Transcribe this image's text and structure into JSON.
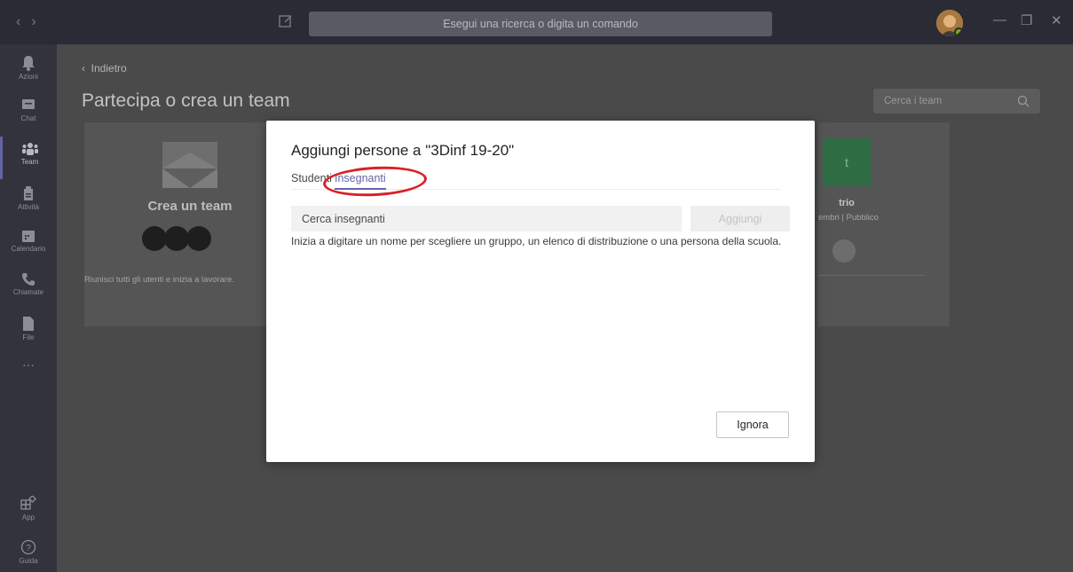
{
  "topbar": {
    "search_placeholder": "Esegui una ricerca o digita un comando",
    "icons": [
      "back-arrow-icon",
      "forward-arrow-icon",
      "compose-icon",
      "minimize-icon",
      "maximize-icon",
      "close-icon"
    ]
  },
  "rail": {
    "items": [
      {
        "label": "Azioni",
        "icon": "bell-icon"
      },
      {
        "label": "Chat",
        "icon": "chat-icon"
      },
      {
        "label": "Team",
        "icon": "team-icon",
        "active": true
      },
      {
        "label": "Attività",
        "icon": "assignments-icon"
      },
      {
        "label": "Calendario",
        "icon": "calendar-icon"
      },
      {
        "label": "Chiamate",
        "icon": "phone-icon"
      },
      {
        "label": "File",
        "icon": "file-icon"
      },
      {
        "label": "App",
        "icon": "apps-icon"
      },
      {
        "label": "Guida",
        "icon": "help-icon"
      }
    ],
    "more_label": "···"
  },
  "main": {
    "back_label": "Indietro",
    "title": "Partecipa o crea un team",
    "team_search_placeholder": "Cerca i team",
    "create_card": {
      "title": "Crea un team",
      "description": "Riunisci tutti gli utenti e inizia a lavorare."
    },
    "trio_card": {
      "tile_letter": "t",
      "name": "trio",
      "meta": "embri | Pubblico"
    }
  },
  "dialog": {
    "title": "Aggiungi persone a \"3Dinf 19-20\"",
    "tabs": [
      {
        "label": "Studenti",
        "active": false
      },
      {
        "label": "Insegnanti",
        "active": true
      }
    ],
    "search_placeholder": "Cerca insegnanti",
    "add_label": "Aggiungi",
    "hint": "Inizia a digitare un nome per scegliere un gruppo, un elenco di distribuzione o una persona della scuola.",
    "ignore_label": "Ignora"
  },
  "colors": {
    "accent": "#6264a7",
    "annotation_red": "#d92127",
    "team_tile": "#2f6e44"
  }
}
